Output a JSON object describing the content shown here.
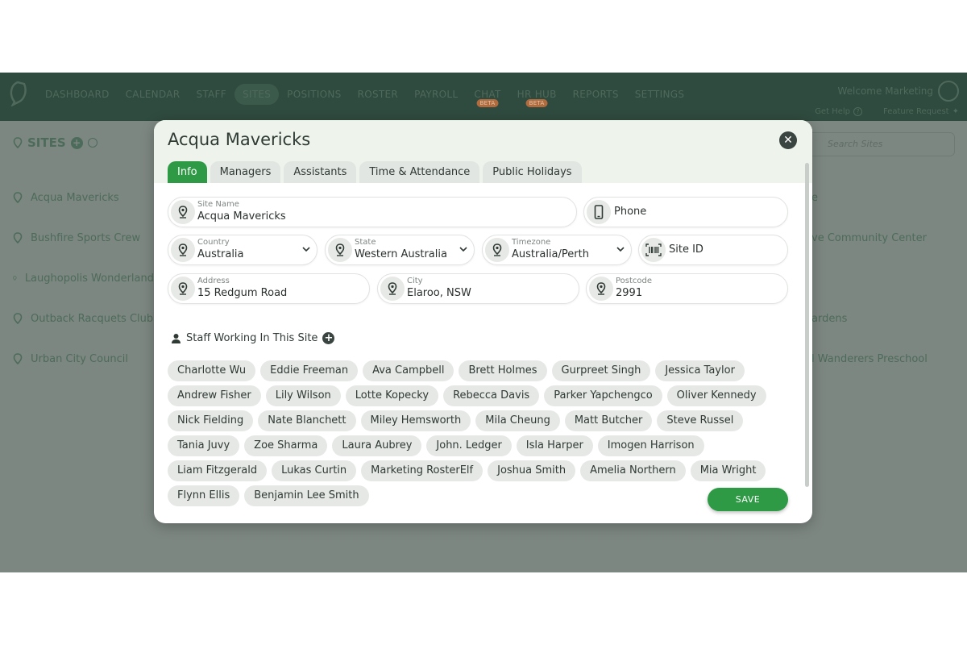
{
  "nav": {
    "items": [
      {
        "label": "DASHBOARD"
      },
      {
        "label": "CALENDAR"
      },
      {
        "label": "STAFF"
      },
      {
        "label": "SITES",
        "active": true
      },
      {
        "label": "POSITIONS"
      },
      {
        "label": "ROSTER"
      },
      {
        "label": "PAYROLL"
      },
      {
        "label": "CHAT",
        "badge": "BETA"
      },
      {
        "label": "HR HUB",
        "badge": "BETA"
      },
      {
        "label": "REPORTS"
      },
      {
        "label": "SETTINGS"
      }
    ],
    "welcome": "Welcome Marketing",
    "help": "Get Help",
    "feature": "Feature Request"
  },
  "sites": {
    "title": "SITES",
    "left_list": [
      "Acqua Mavericks",
      "Bushfire Sports Crew",
      "Laughopolis Wonderland",
      "Outback Racquets Club",
      "Urban City Council"
    ],
    "search_placeholder": "Search Sites",
    "right_list": [
      "e",
      "ve Community Center",
      "",
      "ardens",
      "l Wanderers Preschool"
    ]
  },
  "modal": {
    "title": "Acqua Mavericks",
    "tabs": [
      "Info",
      "Managers",
      "Assistants",
      "Time & Attendance",
      "Public Holidays"
    ],
    "fields": {
      "site_name": {
        "label": "Site Name",
        "value": "Acqua Mavericks"
      },
      "phone": {
        "placeholder": "Phone"
      },
      "country": {
        "label": "Country",
        "value": "Australia"
      },
      "state": {
        "label": "State",
        "value": "Western Australia"
      },
      "timezone": {
        "label": "Timezone",
        "value": "Australia/Perth"
      },
      "site_id": {
        "placeholder": "Site ID"
      },
      "address": {
        "label": "Address",
        "value": "15 Redgum Road"
      },
      "city": {
        "label": "City",
        "value": "Elaroo, NSW"
      },
      "postcode": {
        "label": "Postcode",
        "value": "2991"
      }
    },
    "staff_heading": "Staff Working In This Site",
    "staff": [
      "Charlotte Wu",
      "Eddie Freeman",
      "Ava Campbell",
      "Brett Holmes",
      "Gurpreet Singh",
      "Jessica Taylor",
      "Andrew Fisher",
      "Lily Wilson",
      "Lotte Kopecky",
      "Rebecca Davis",
      "Parker Yapchengco",
      "Oliver Kennedy",
      "Nick Fielding",
      "Nate Blanchett",
      "Miley Hemsworth",
      "Mila Cheung",
      "Matt Butcher",
      "Steve Russel",
      "Tania Juvy",
      "Zoe Sharma",
      "Laura Aubrey",
      "John. Ledger",
      "Isla Harper",
      "Imogen Harrison",
      "Liam Fitzgerald",
      "Lukas Curtin",
      "Marketing RosterElf",
      "Joshua Smith",
      "Amelia Northern",
      "Mia Wright",
      "Flynn Ellis",
      "Benjamin Lee Smith"
    ],
    "save_label": "SAVE"
  },
  "icons": {
    "location": "location-pin-icon",
    "phone": "mobile-phone-icon",
    "site_id": "barcode-icon",
    "person": "person-icon",
    "close": "close-icon",
    "chevron": "chevron-down-icon"
  },
  "colors": {
    "accent": "#2f9a46",
    "overlay": "#7d8782",
    "topbar": "#2f4a3e"
  }
}
